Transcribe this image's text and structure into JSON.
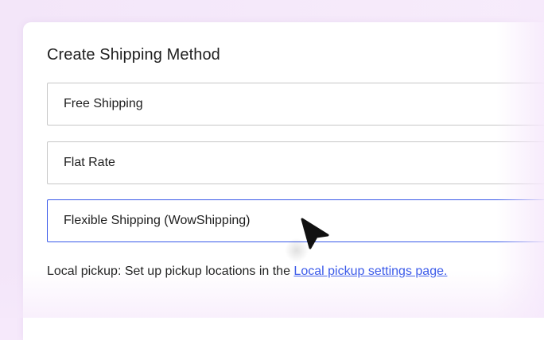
{
  "panel": {
    "title": "Create Shipping Method"
  },
  "methods": [
    {
      "label": "Free Shipping",
      "selected": false
    },
    {
      "label": "Flat Rate",
      "selected": false
    },
    {
      "label": "Flexible Shipping (WowShipping)",
      "selected": true
    }
  ],
  "pickup": {
    "text": "Local pickup: Set up pickup locations in the ",
    "link_text": "Local pickup settings page."
  },
  "colors": {
    "accent": "#3858e9",
    "background": "#f6e9fb",
    "border": "#c7c7c7"
  },
  "icons": {
    "pointer": "mouse-pointer-icon"
  }
}
